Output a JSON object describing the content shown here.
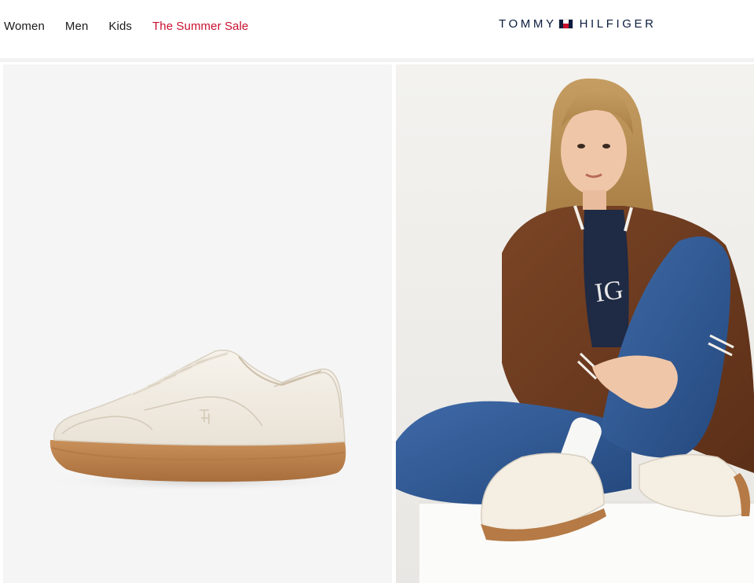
{
  "nav": {
    "items": [
      {
        "label": "Women"
      },
      {
        "label": "Men"
      },
      {
        "label": "Kids"
      },
      {
        "label": "The Summer Sale",
        "color": "#c8102e"
      }
    ]
  },
  "brand": {
    "name_left": "TOMMY",
    "name_right": "HILFIGER",
    "logo_icon": "tommy-flag-icon",
    "colors": {
      "navy": "#0b1c3d",
      "red": "#c8102e",
      "white": "#ffffff"
    }
  },
  "gallery": {
    "left_image": "white leather sneaker with gum sole, side view",
    "right_image": "model in brown varsity jacket and blue jeans wearing white sneakers, seated on white block"
  }
}
